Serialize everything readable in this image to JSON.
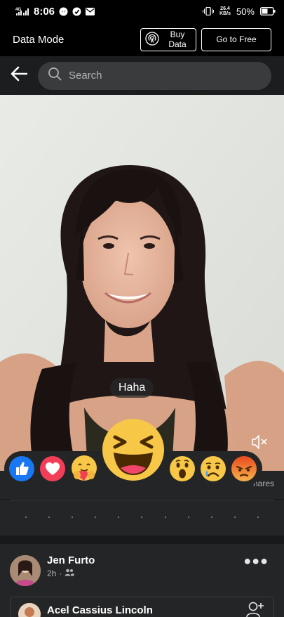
{
  "status_bar": {
    "network": "4G",
    "time": "8:06",
    "speed_value": "26.4",
    "speed_unit": "KB/s",
    "battery": "50%",
    "icons": [
      "signal-icon",
      "messenger-icon",
      "opera-icon",
      "mail-icon",
      "vibrate-icon",
      "battery-icon"
    ]
  },
  "data_mode": {
    "title": "Data Mode",
    "buy_label": "Buy Data",
    "free_label": "Go to Free"
  },
  "search": {
    "placeholder": "Search"
  },
  "video": {
    "reaction_label": "Haha",
    "reactions": [
      "like",
      "love",
      "care",
      "haha",
      "wow",
      "sad",
      "angry"
    ],
    "selected_reaction": "haha",
    "muted": true
  },
  "stats": {
    "shares_text": "hares"
  },
  "post": {
    "author": "Jen Furto",
    "time": "2h",
    "audience_icon": "friends-icon",
    "shared_author": "Acel Cassius Lincoln"
  }
}
